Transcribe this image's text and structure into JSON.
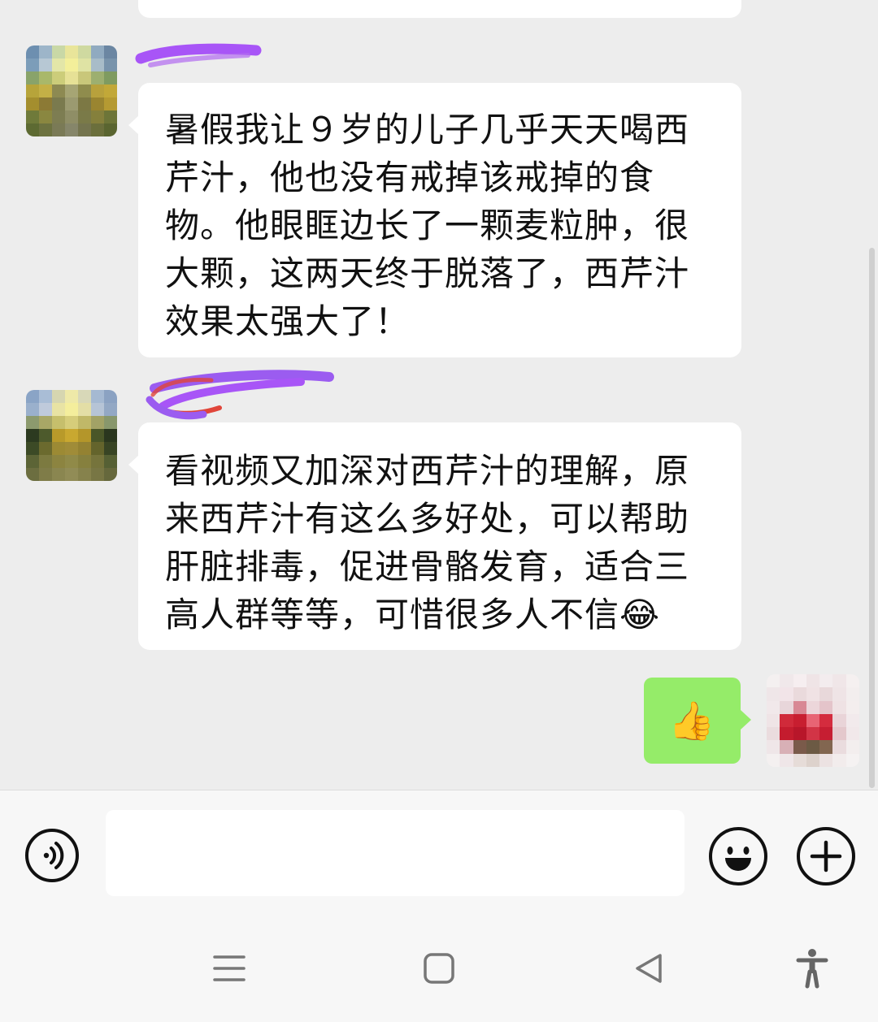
{
  "chat": {
    "messages": [
      {
        "sender": "other",
        "text": "暑假我让９岁的儿子几乎天天喝西芹汁，他也没有戒掉该戒掉的食物。他眼眶边长了一颗麦粒肿，很大颗，这两天终于脱落了，西芹汁效果太强大了！"
      },
      {
        "sender": "other",
        "text": "看视频又加深对西芹汁的理解，原来西芹汁有这么多好处，可以帮助肝脏排毒，促进骨骼发育，适合三高人群等等，可惜很多人不信😂"
      },
      {
        "sender": "me",
        "text": "👍"
      }
    ]
  },
  "input_bar": {
    "voice_icon": "voice-icon",
    "emoji_icon": "emoji-icon",
    "plus_icon": "plus-icon"
  },
  "nav_bar": {
    "icons": [
      "menu-icon",
      "home-icon",
      "back-icon",
      "accessibility-icon"
    ]
  },
  "colors": {
    "chat_background": "#ededed",
    "my_bubble": "#95ec69",
    "other_bubble": "#ffffff",
    "name_scribble": "#a855f7"
  }
}
